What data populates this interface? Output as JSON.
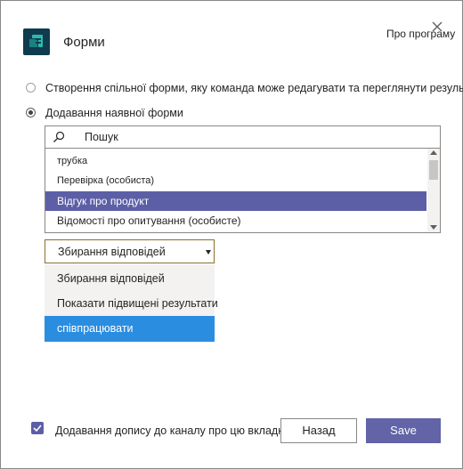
{
  "header": {
    "app_icon": "forms-app-icon",
    "title": "Форми",
    "about_label": "Про програму",
    "close_icon": "close-icon"
  },
  "options": {
    "create_shared": "Створення спільної форми, яку команда може редагувати та переглянути результати",
    "add_existing": "Додавання наявної форми",
    "selected": "add_existing"
  },
  "search": {
    "icon": "search-icon",
    "placeholder": "Пошук"
  },
  "form_list": {
    "items": [
      "трубка",
      "Перевірка (особиста)",
      "Відгук про продукт",
      "Відомості про опитування (особисте)"
    ],
    "selected_index": 2
  },
  "mode_dropdown": {
    "value": "Збирання відповідей",
    "options": [
      "Збирання відповідей",
      "Показати підвищені результати",
      "співпрацювати"
    ],
    "highlighted_index": 2
  },
  "footer": {
    "post_to_channel_label": "Додавання допису до каналу про цю вкладку",
    "post_to_channel_checked": true,
    "back_label": "Назад",
    "save_label": "Save"
  },
  "colors": {
    "accent": "#6264a7",
    "selected_row": "#5c5fa6",
    "menu_highlight": "#2b8de0",
    "app_icon_bg": "#0f3b4f"
  }
}
